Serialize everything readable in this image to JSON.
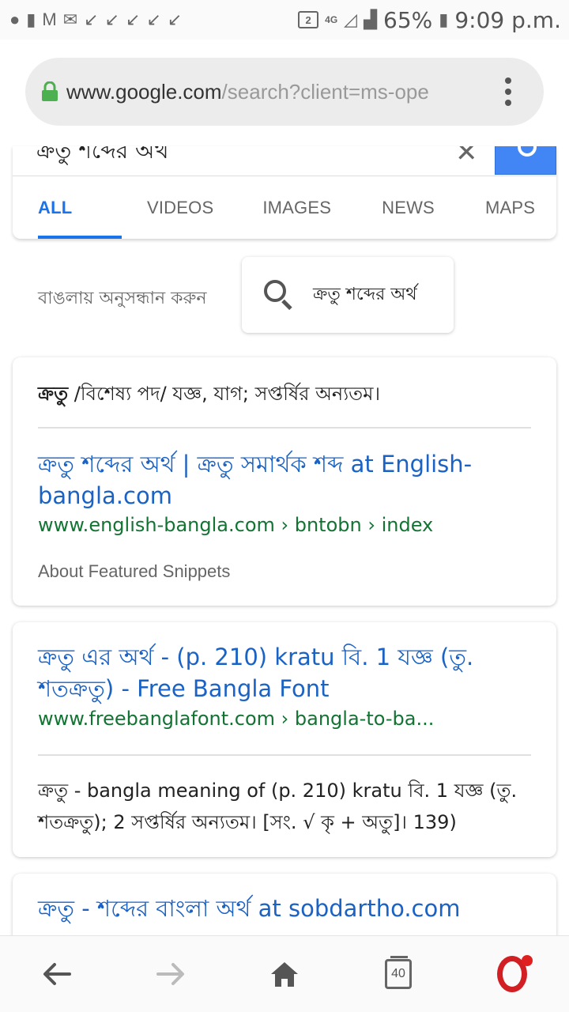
{
  "status_bar": {
    "badge_number": "2",
    "network_label": "4G",
    "battery_percent": "65%",
    "time": "9:09 p.m."
  },
  "browser": {
    "url_host": "www.google.com",
    "url_path": "/search?client=ms-ope",
    "lock_color": "#4caf50"
  },
  "search": {
    "query": "ক্রতু শব্দের অর্থ",
    "clear_symbol": "✕",
    "button_color": "#4285f4",
    "tabs": [
      {
        "label": "ALL",
        "active": true
      },
      {
        "label": "VIDEOS",
        "active": false
      },
      {
        "label": "IMAGES",
        "active": false
      },
      {
        "label": "NEWS",
        "active": false
      },
      {
        "label": "MAPS",
        "active": false
      }
    ]
  },
  "language_suggest": {
    "label": "বাঙলায় অনুসন্ধান করুন",
    "chip_text": "ক্রতু শব্দের অর্থ"
  },
  "featured_snippet": {
    "term": "ক্রতু",
    "definition": " /বিশেষ্য পদ/ যজ্ঞ, যাগ; সপ্তর্ষির অন্যতম।",
    "title": "ক্রতু শব্দের অর্থ | ক্রতু সমার্থক শব্দ at English-bangla.com",
    "url": "www.english-bangla.com › bntobn › index",
    "about": "About Featured Snippets"
  },
  "results": [
    {
      "title": "ক্রতু এর অর্থ - (p. 210) kratu বি. 1 যজ্ঞ (তু. শতক্রতু) - Free Bangla Font",
      "url": "www.freebanglafont.com › bangla-to-ba...",
      "description": "ক্রতু - bangla meaning of (p. 210) kratu বি. 1 যজ্ঞ (তু. শতক্রতু); 2 সপ্তর্ষির অন্যতম। [সং. √ কৃ + অতু]। 139)"
    },
    {
      "title": "ক্রতু - শব্দের বাংলা অর্থ at sobdartho.com"
    }
  ],
  "bottom_nav": {
    "back_icon": "←",
    "forward_icon": "→",
    "tab_count": "40"
  },
  "colors": {
    "link": "#1a62c4",
    "url_green": "#137333",
    "accent": "#1a73e8",
    "opera_red": "#d11f24"
  }
}
